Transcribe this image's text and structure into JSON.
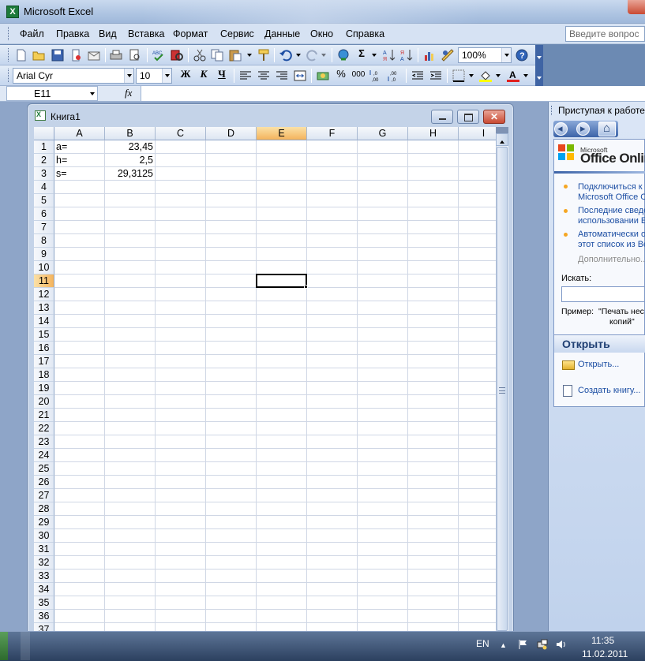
{
  "app": {
    "title": "Microsoft Excel"
  },
  "menu": [
    "Файл",
    "Правка",
    "Вид",
    "Вставка",
    "Формат",
    "Сервис",
    "Данные",
    "Окно",
    "Справка"
  ],
  "help_box": {
    "placeholder": "Введите вопрос"
  },
  "toolbar": {
    "zoom": "100%",
    "font": "Arial Cyr",
    "size": "10",
    "bold": "Ж",
    "italic": "К",
    "underline": "Ч"
  },
  "formula_bar": {
    "name_box": "E11",
    "fx": "fx",
    "value": ""
  },
  "workbook": {
    "title": "Книга1"
  },
  "grid": {
    "columns": [
      "A",
      "B",
      "C",
      "D",
      "E",
      "F",
      "G",
      "H",
      "I"
    ],
    "selected_column": "E",
    "selected_row": "11",
    "rows": [
      "1",
      "2",
      "3",
      "4",
      "5",
      "6",
      "7",
      "8",
      "9",
      "10",
      "11",
      "12",
      "13",
      "14",
      "15",
      "16",
      "17",
      "18",
      "19",
      "20",
      "21",
      "22",
      "23",
      "24",
      "25",
      "26",
      "27",
      "28",
      "29",
      "30",
      "31",
      "32",
      "33",
      "34",
      "35",
      "36",
      "37"
    ],
    "cells": {
      "A1": "a=",
      "B1": "23,45",
      "A2": "h=",
      "B2": "2,5",
      "A3": "s=",
      "B3": "29,3125"
    }
  },
  "task_pane": {
    "title": "Приступая к работе",
    "logo_small": "Microsoft",
    "logo_big": "Office Onlin",
    "links": [
      [
        "Подключиться к",
        "Microsoft Office O"
      ],
      [
        "Последние сведе",
        "использовании E"
      ],
      [
        "Автоматически о",
        "этот список из Be"
      ]
    ],
    "more": "Дополнительно...",
    "search_label": "Искать:",
    "example_label": "Пример:",
    "example_text_1": "\"Печать нес",
    "example_text_2": "копий\"",
    "open_title": "Открыть",
    "open_link": "Открыть...",
    "new_link": "Создать книгу..."
  },
  "taskbar": {
    "lang": "EN",
    "time": "11:35",
    "date": "11.02.2011"
  }
}
